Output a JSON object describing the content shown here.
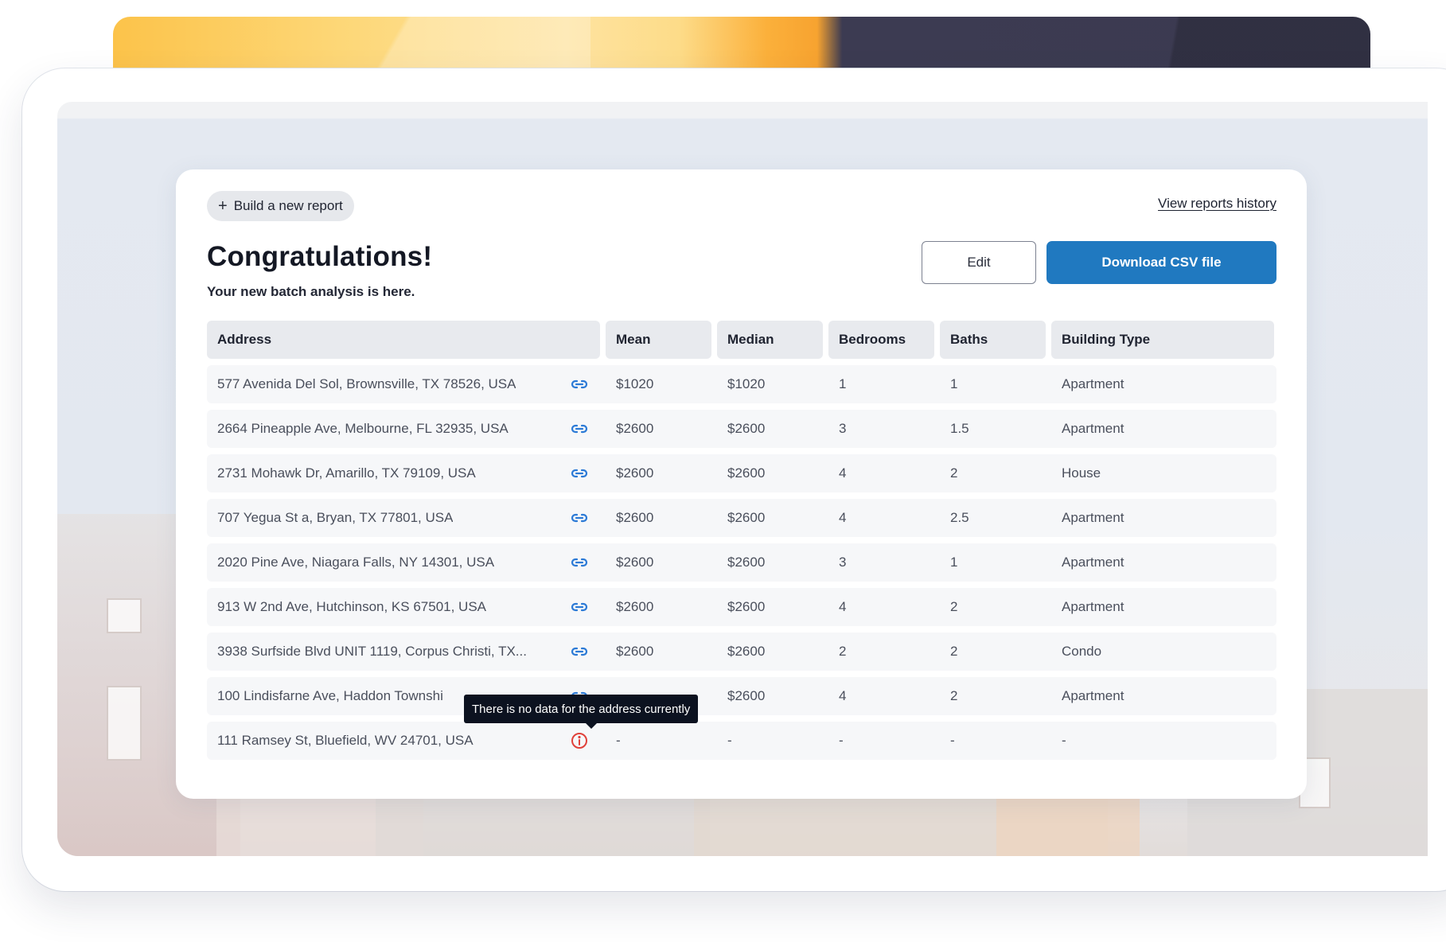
{
  "actions": {
    "new_report_label": "Build a new report",
    "history_link": "View reports history",
    "edit_label": "Edit",
    "download_label": "Download CSV file"
  },
  "header": {
    "title": "Congratulations!",
    "subtitle": "Your new batch analysis is here."
  },
  "table": {
    "columns": [
      "Address",
      "Mean",
      "Median",
      "Bedrooms",
      "Baths",
      "Building Type"
    ],
    "rows": [
      {
        "address": "577 Avenida Del Sol, Brownsville, TX 78526, USA",
        "mean": "$1020",
        "median": "$1020",
        "bedrooms": "1",
        "baths": "1",
        "type": "Apartment",
        "icon": "link-icon"
      },
      {
        "address": "2664 Pineapple Ave, Melbourne, FL 32935, USA",
        "mean": "$2600",
        "median": "$2600",
        "bedrooms": "3",
        "baths": "1.5",
        "type": "Apartment",
        "icon": "link-icon"
      },
      {
        "address": "2731 Mohawk Dr, Amarillo, TX 79109, USA",
        "mean": "$2600",
        "median": "$2600",
        "bedrooms": "4",
        "baths": "2",
        "type": "House",
        "icon": "link-icon"
      },
      {
        "address": "707 Yegua St a, Bryan, TX 77801, USA",
        "mean": "$2600",
        "median": "$2600",
        "bedrooms": "4",
        "baths": "2.5",
        "type": "Apartment",
        "icon": "link-icon"
      },
      {
        "address": "2020 Pine Ave, Niagara Falls, NY 14301, USA",
        "mean": "$2600",
        "median": "$2600",
        "bedrooms": "3",
        "baths": "1",
        "type": "Apartment",
        "icon": "link-icon"
      },
      {
        "address": "913 W 2nd Ave, Hutchinson, KS 67501, USA",
        "mean": "$2600",
        "median": "$2600",
        "bedrooms": "4",
        "baths": "2",
        "type": "Apartment",
        "icon": "link-icon"
      },
      {
        "address": "3938 Surfside Blvd UNIT 1119, Corpus Christi, TX...",
        "mean": "$2600",
        "median": "$2600",
        "bedrooms": "2",
        "baths": "2",
        "type": "Condo",
        "icon": "link-icon"
      },
      {
        "address": "100 Lindisfarne Ave, Haddon Townshi",
        "mean": "",
        "median": "$2600",
        "bedrooms": "4",
        "baths": "2",
        "type": "Apartment",
        "icon": "link-icon"
      },
      {
        "address": "111 Ramsey St, Bluefield, WV 24701, USA",
        "mean": "-",
        "median": "-",
        "bedrooms": "-",
        "baths": "-",
        "type": "-",
        "icon": "info-icon"
      }
    ]
  },
  "tooltip": {
    "text": "There is no data for the address currently"
  },
  "colors": {
    "accent": "#2079c0",
    "link_icon": "#2c7ad6",
    "error_icon": "#e0413a",
    "tooltip_bg": "#0c1220"
  }
}
